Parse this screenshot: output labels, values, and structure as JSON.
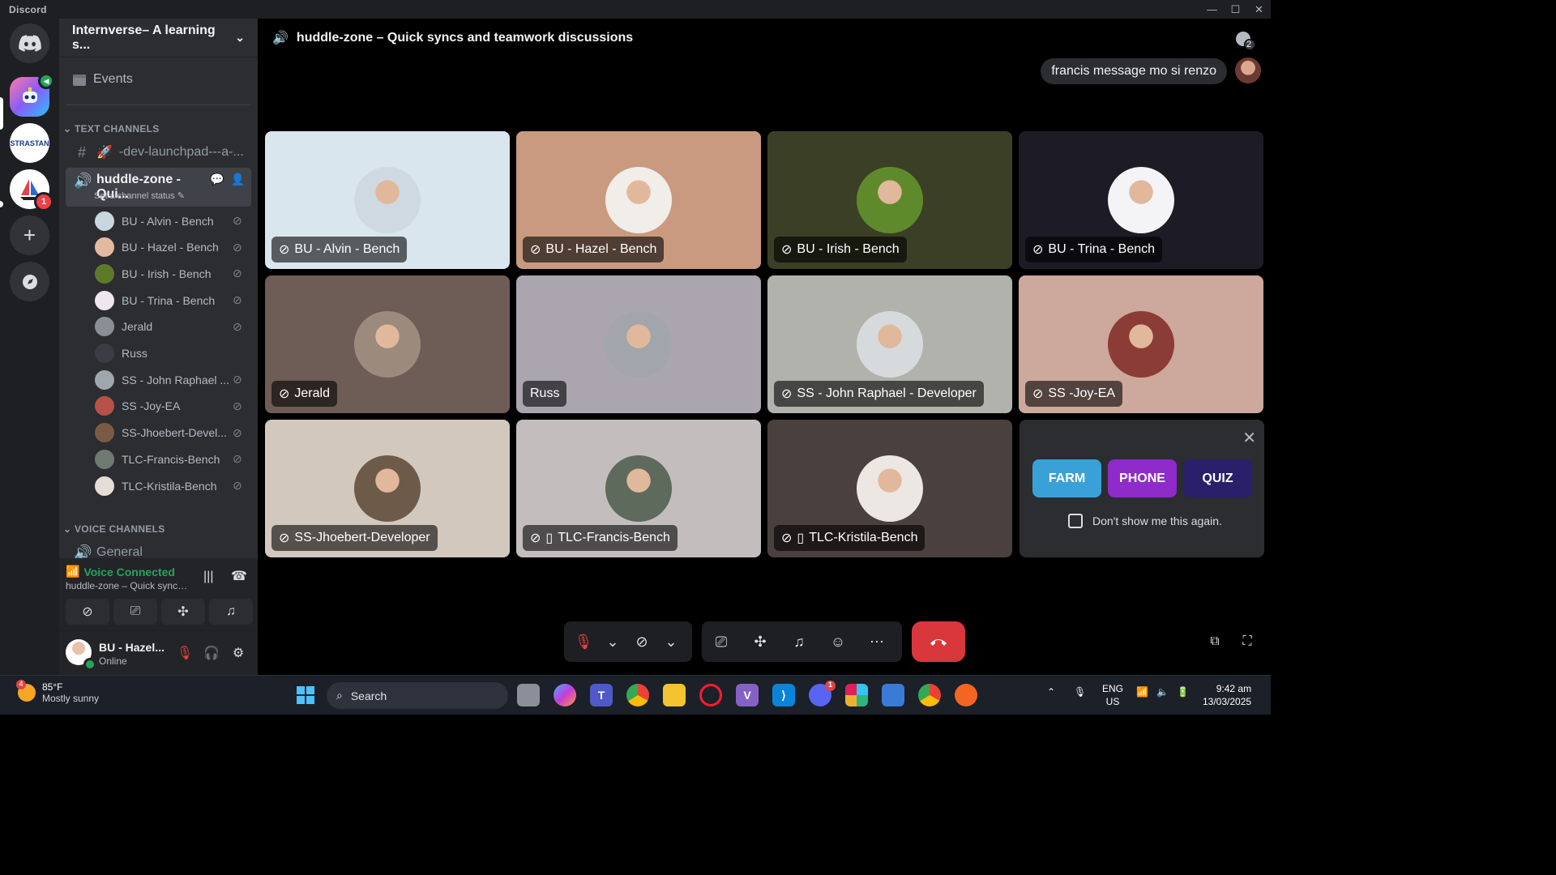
{
  "window": {
    "brand": "Discord"
  },
  "server": {
    "name": "Internverse– A learning s...",
    "events_label": "Events",
    "badge_count": "1",
    "notif_count": "2",
    "srv2_text": "STRASTAN"
  },
  "categories": {
    "text": "TEXT CHANNELS",
    "voice": "VOICE CHANNELS"
  },
  "channels": {
    "dev": "-dev-launchpad---a-...",
    "huddle": "huddle-zone - Qui...",
    "huddle_status": "Set a channel status",
    "general": "General"
  },
  "members": [
    {
      "name": "BU - Alvin - Bench",
      "color": "#c8d6e0"
    },
    {
      "name": "BU - Hazel - Bench",
      "color": "#e3b9a2"
    },
    {
      "name": "BU - Irish - Bench",
      "color": "#5c7a2a"
    },
    {
      "name": "BU - Trina - Bench",
      "color": "#f0e6f0"
    },
    {
      "name": "Jerald",
      "color": "#8a8f96"
    },
    {
      "name": "Russ",
      "color": "#3a3d44"
    },
    {
      "name": "SS - John Raphael ...",
      "color": "#9fa6ad"
    },
    {
      "name": "SS -Joy-EA",
      "color": "#b6514a"
    },
    {
      "name": "SS-Jhoebert-Devel...",
      "color": "#7a5a44"
    },
    {
      "name": "TLC-Francis-Bench",
      "color": "#6f7a72"
    },
    {
      "name": "TLC-Kristila-Bench",
      "color": "#e6dcd6"
    }
  ],
  "voice": {
    "title": "Voice Connected",
    "sub": "huddle-zone – Quick syncs ..."
  },
  "user": {
    "name": "BU - Hazel...",
    "status": "Online"
  },
  "main": {
    "channel_title": "huddle-zone – Quick syncs and teamwork discussions",
    "chat_message": "francis message mo si renzo",
    "inbox_count": "2"
  },
  "tiles": [
    {
      "label": "BU - Alvin - Bench",
      "bg": "#d9e6ee",
      "muted": true,
      "mobile": false,
      "avatar": "#cfd9e1"
    },
    {
      "label": "BU - Hazel - Bench",
      "bg": "#c99a80",
      "muted": true,
      "mobile": false,
      "avatar": "#f1ede9"
    },
    {
      "label": "BU - Irish - Bench",
      "bg": "#3b3f26",
      "muted": true,
      "mobile": false,
      "avatar": "#5f8a2c"
    },
    {
      "label": "BU - Trina - Bench",
      "bg": "#1d1c26",
      "muted": true,
      "mobile": false,
      "avatar": "#f4f4f6"
    },
    {
      "label": "Jerald",
      "bg": "#6e5c56",
      "muted": true,
      "mobile": false,
      "avatar": "#9c8a7c"
    },
    {
      "label": "Russ",
      "bg": "#aaa5ae",
      "muted": false,
      "mobile": false,
      "avatar": "#a2a6ac"
    },
    {
      "label": "SS - John Raphael - Developer",
      "bg": "#b0b2ab",
      "muted": true,
      "mobile": false,
      "avatar": "#d7dadc"
    },
    {
      "label": "SS -Joy-EA",
      "bg": "#cda89c",
      "muted": true,
      "mobile": false,
      "avatar": "#8c3c36"
    },
    {
      "label": "SS-Jhoebert-Developer",
      "bg": "#d2c8bd",
      "muted": true,
      "mobile": false,
      "avatar": "#6e5a48"
    },
    {
      "label": "TLC-Francis-Bench",
      "bg": "#c3bebd",
      "muted": true,
      "mobile": true,
      "avatar": "#5e6a5c"
    },
    {
      "label": "TLC-Kristila-Bench",
      "bg": "#4a403e",
      "muted": true,
      "mobile": true,
      "avatar": "#ede7e3"
    }
  ],
  "promo": {
    "games": [
      {
        "name": "FARM",
        "color": "#3aa1d8"
      },
      {
        "name": "PHONE",
        "color": "#8e2bc9"
      },
      {
        "name": "QUIZ",
        "color": "#2a1f6b"
      }
    ],
    "checkbox_label": "Don't show me this again."
  },
  "taskbar": {
    "weather_temp": "85°F",
    "weather_desc": "Mostly sunny",
    "weather_badge": "4",
    "search_label": "Search",
    "discord_badge": "1",
    "lang1": "ENG",
    "lang2": "US",
    "time": "9:42 am",
    "date": "13/03/2025"
  },
  "colors": {
    "accent": "#5865f2",
    "green": "#23a559",
    "red": "#da373c"
  }
}
